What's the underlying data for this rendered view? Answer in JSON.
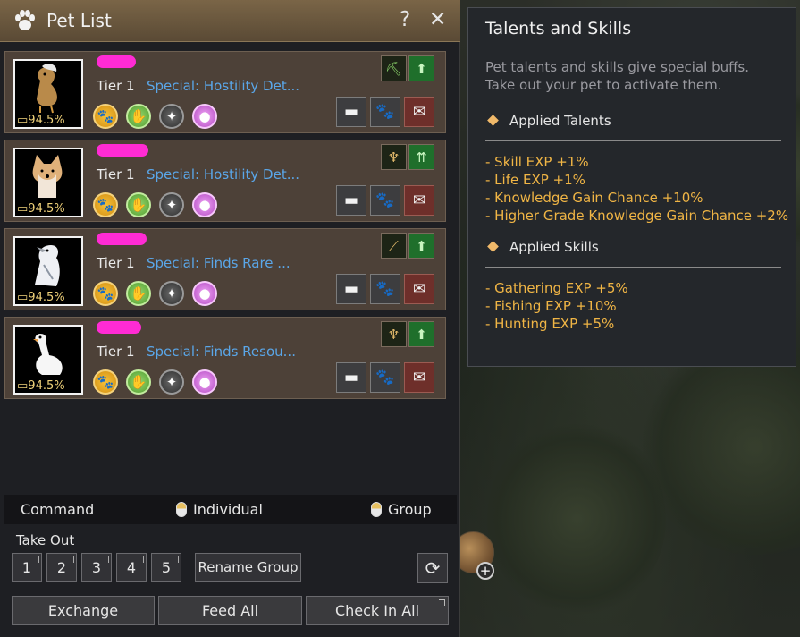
{
  "window": {
    "title": "Pet List",
    "help_label": "?",
    "close_label": "✕"
  },
  "pets": [
    {
      "tier": "Tier 1",
      "special": "Special: Hostility Det...",
      "hunger": "94.5%",
      "animal": "chocobo-bird"
    },
    {
      "tier": "Tier 1",
      "special": "Special: Hostility Det...",
      "hunger": "94.5%",
      "animal": "shiba-dog"
    },
    {
      "tier": "Tier 1",
      "special": "Special: Finds Rare ...",
      "hunger": "94.5%",
      "animal": "white-falcon"
    },
    {
      "tier": "Tier 1",
      "special": "Special: Finds Resou...",
      "hunger": "94.5%",
      "animal": "white-goose"
    }
  ],
  "command_bar": {
    "command_label": "Command",
    "individual_label": "Individual",
    "group_label": "Group"
  },
  "take_out": {
    "label": "Take Out",
    "groups": [
      "1",
      "2",
      "3",
      "4",
      "5"
    ],
    "rename_label": "Rename Group"
  },
  "bottom_buttons": {
    "exchange": "Exchange",
    "feed_all": "Feed All",
    "check_in_all": "Check In All"
  },
  "tooltip": {
    "title": "Talents and Skills",
    "description_line1": "Pet talents and skills give special buffs.",
    "description_line2": "Take out your pet to activate them.",
    "talents_heading": "Applied Talents",
    "talents": [
      "- Skill EXP +1%",
      "- Life EXP +1%",
      "- Knowledge Gain Chance +10%",
      "- Higher Grade Knowledge Gain Chance +2%"
    ],
    "skills_heading": "Applied Skills",
    "skills": [
      "- Gathering EXP +5%",
      "- Fishing EXP +10%",
      "- Hunting EXP +5%"
    ]
  },
  "colors": {
    "title_bar": "#6b583f",
    "card_bg": "#4d4138",
    "special_text": "#5aa6e8",
    "tooltip_list": "#f0b545",
    "name_redaction": "#ff2bd4"
  }
}
